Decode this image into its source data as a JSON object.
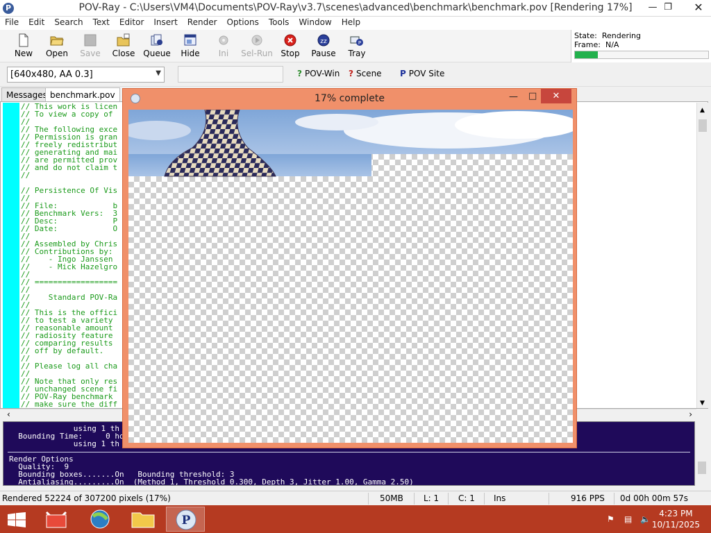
{
  "window": {
    "title": "POV-Ray - C:\\Users\\VM4\\Documents\\POV-Ray\\v3.7\\scenes\\advanced\\benchmark\\benchmark.pov [Rendering 17%]"
  },
  "menu": [
    "File",
    "Edit",
    "Search",
    "Text",
    "Editor",
    "Insert",
    "Render",
    "Options",
    "Tools",
    "Window",
    "Help"
  ],
  "toolbar": {
    "new": "New",
    "open": "Open",
    "save": "Save",
    "close": "Close",
    "queue": "Queue",
    "hide": "Hide",
    "ini": "Ini",
    "selrun": "Sel-Run",
    "stop": "Stop",
    "pause": "Pause",
    "tray": "Tray"
  },
  "state": {
    "state_label": "State:",
    "state_value": "Rendering",
    "frame_label": "Frame:",
    "frame_value": "N/A",
    "progress": 0.17
  },
  "toolbar2": {
    "resolution": "[640x480, AA 0.3]",
    "povwin": "POV-Win",
    "scene": "Scene",
    "povsite": "POV Site"
  },
  "tabs": [
    "Messages",
    "benchmark.pov"
  ],
  "editor_lines": [
    "// This work is licen",
    "// To view a copy of",
    "//",
    "// The following exce",
    "// Permission is gran",
    "// freely redistribut",
    "// generating and mai",
    "// are permitted prov",
    "// and do not claim t",
    "//",
    "",
    "// Persistence Of Vis",
    "//",
    "// File:            b",
    "// Benchmark Vers:  3",
    "// Desc:            P",
    "// Date:            O",
    "//",
    "// Assembled by Chris",
    "// Contributions by:",
    "//    - Ingo Janssen",
    "//    - Mick Hazelgro",
    "//",
    "// ==================",
    "//",
    "//    Standard POV-Ra",
    "//",
    "// This is the offici",
    "// to test a variety",
    "// reasonable amount",
    "// radiosity feature",
    "// comparing results",
    "// off by default.",
    "//",
    "// Please log all cha",
    "//",
    "// Note that only res",
    "// unchanged scene fi",
    "// POV-Ray benchmark",
    "// make sure the diff"
  ],
  "messages": {
    "line1": "              using 1 th",
    "line2": "  Bounding Time:     0 ho",
    "line3": "              using 1 th",
    "line4": "Render Options",
    "line5": "  Quality:  9",
    "line6": "  Bounding boxes.......On   Bounding threshold: 3",
    "line7": "  Antialiasing.........On  (Method 1, Threshold 0.300, Depth 3, Jitter 1.00, Gamma 2.50)"
  },
  "render_window": {
    "title": "17% complete"
  },
  "statusbar": {
    "rendered": "Rendered 52224 of 307200 pixels (17%)",
    "memory": "50MB",
    "line": "L: 1",
    "col": "C: 1",
    "mode": "Ins",
    "pps": "916 PPS",
    "elapsed": "0d 00h 00m 57s"
  },
  "taskbar": {
    "time": "4:23 PM",
    "date": "10/11/2025"
  }
}
